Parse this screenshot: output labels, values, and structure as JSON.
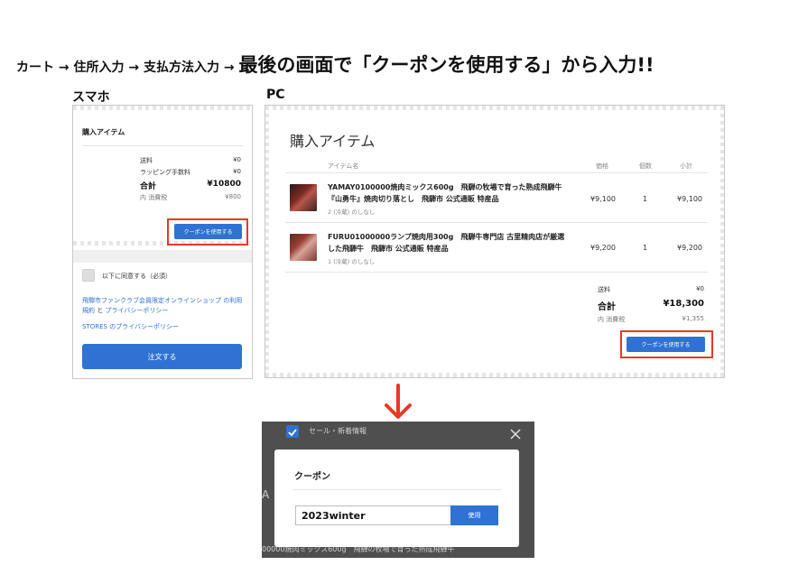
{
  "headline": {
    "part1": "カート → 住所入力 → 支払方法入力 → ",
    "part2": "最後の画面で「クーポンを使用する」から入力!!"
  },
  "labels": {
    "smartphone": "スマホ",
    "pc": "PC"
  },
  "colors": {
    "accent_blue": "#2f72d3",
    "highlight_red": "#e53a24",
    "arrow_red": "#e53a24",
    "overlay": "#4f4f4f"
  },
  "phone": {
    "title": "購入アイテム",
    "summary": [
      {
        "label": "送料",
        "value": "¥0"
      },
      {
        "label": "ラッピング手数料",
        "value": "¥0"
      },
      {
        "label": "合計",
        "value": "¥10800"
      },
      {
        "label": "内 消費税",
        "value": "¥800"
      }
    ],
    "coupon_button": "クーポンを使用する",
    "agree_label": "以下に同意する（必須）",
    "terms_link": "飛騨市ファンクラブ会員限定オンラインショップ の利用規約",
    "and_text": " と ",
    "privacy_link": "プライバシーポリシー",
    "stores_privacy_link": "STORES のプライバシーポリシー",
    "order_button": "注文する"
  },
  "pc": {
    "title": "購入アイテム",
    "columns": {
      "item": "アイテム名",
      "price": "価格",
      "qty": "個数",
      "subtotal": "小計"
    },
    "items": [
      {
        "name": "YAMAY0100000焼肉ミックス600g　飛騨の牧場で育った熟成飛騨牛『山勇牛』焼肉切り落とし　飛騨市 公式通販 特産品",
        "note": "2 (冷蔵) のしなし",
        "price": "¥9,100",
        "qty": "1",
        "subtotal": "¥9,100"
      },
      {
        "name": "FURU01000000ランプ焼肉用300g　飛騨牛専門店 古里精肉店が厳選した飛騨牛　飛騨市 公式通販 特産品",
        "note": "1 (冷蔵) のしなし",
        "price": "¥9,200",
        "qty": "1",
        "subtotal": "¥9,200"
      }
    ],
    "summary": [
      {
        "label": "送料",
        "value": "¥0"
      },
      {
        "label": "合計",
        "value": "¥18,300"
      },
      {
        "label": "内 消費税",
        "value": "¥1,355"
      }
    ],
    "coupon_button": "クーポンを使用する"
  },
  "modal": {
    "background_checkbox_label": "セール・新着情報",
    "background_glyph": "A",
    "background_bottom_text": "00000焼肉ミックス600g　飛騨の牧場で育った熟成飛騨牛",
    "title": "クーポン",
    "coupon_value": "2023winter",
    "apply_button": "使用"
  }
}
